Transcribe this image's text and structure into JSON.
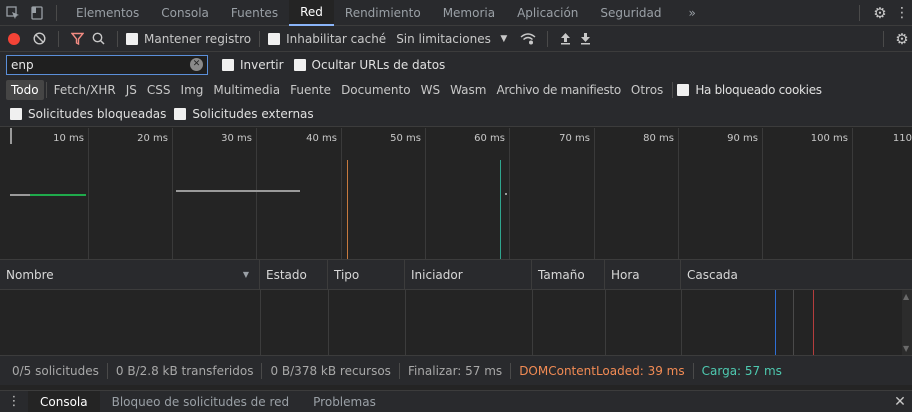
{
  "tabs": {
    "items": [
      "Elementos",
      "Consola",
      "Fuentes",
      "Red",
      "Rendimiento",
      "Memoria",
      "Aplicación",
      "Seguridad"
    ],
    "more": "»"
  },
  "toolbar": {
    "preserve_log": "Mantener registro",
    "disable_cache": "Inhabilitar caché",
    "throttling": "Sin limitaciones"
  },
  "filter": {
    "value": "enp",
    "invert": "Invertir",
    "hide_data_urls": "Ocultar URLs de datos"
  },
  "types": {
    "items": [
      "Todo",
      "Fetch/XHR",
      "JS",
      "CSS",
      "Img",
      "Multimedia",
      "Fuente",
      "Documento",
      "WS",
      "Wasm",
      "Archivo de manifiesto",
      "Otros"
    ],
    "blocked_cookies": "Ha bloqueado cookies"
  },
  "blocked": {
    "blocked_requests": "Solicitudes bloqueadas",
    "third_party": "Solicitudes externas"
  },
  "overview": {
    "ticks": [
      "10 ms",
      "20 ms",
      "30 ms",
      "40 ms",
      "50 ms",
      "60 ms",
      "70 ms",
      "80 ms",
      "90 ms",
      "100 ms",
      "110"
    ]
  },
  "table": {
    "columns": [
      "Nombre",
      "Estado",
      "Tipo",
      "Iniciador",
      "Tamaño",
      "Hora",
      "Cascada"
    ]
  },
  "status": {
    "requests": "0/5 solicitudes",
    "transferred": "0 B/2.8 kB transferidos",
    "resources": "0 B/378 kB recursos",
    "finish": "Finalizar: 57 ms",
    "dom_loaded": "DOMContentLoaded: 39 ms",
    "load": "Carga: 57 ms"
  },
  "drawer": {
    "items": [
      "Consola",
      "Bloqueo de solicitudes de red",
      "Problemas"
    ]
  },
  "colors": {
    "dom_loaded": "#f28b54",
    "load": "#4ec9b0",
    "record": "#f44336",
    "accent": "#8ab4f8"
  }
}
